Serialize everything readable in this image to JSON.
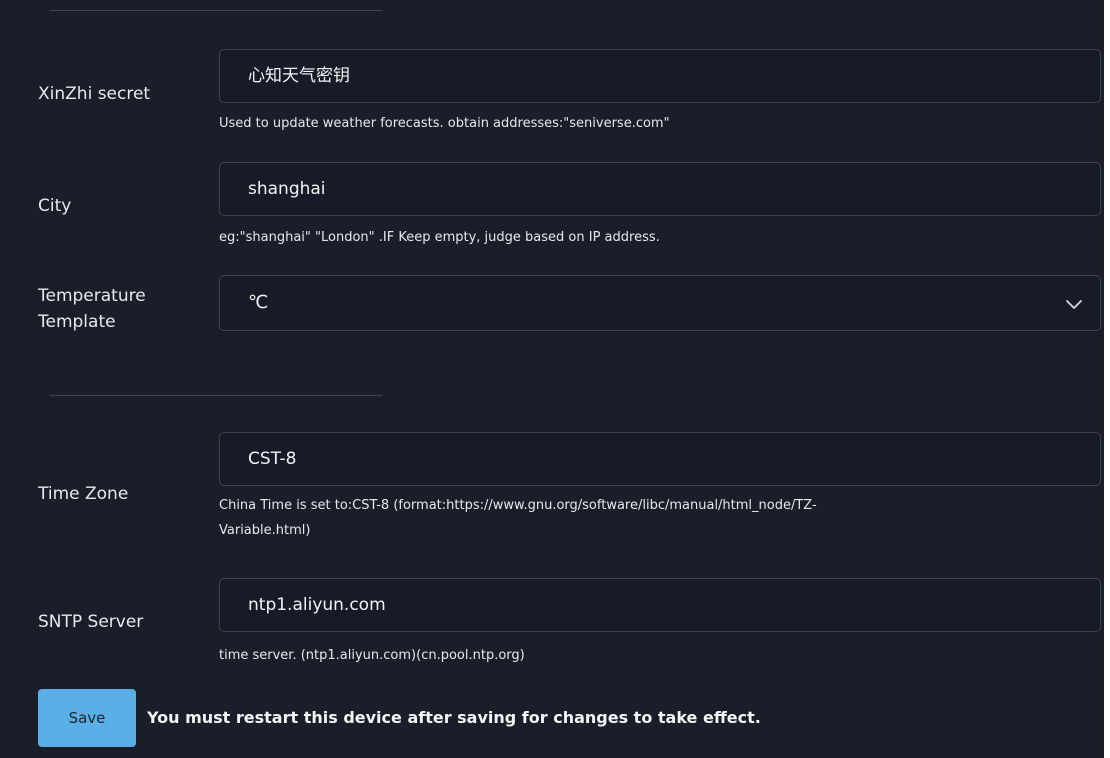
{
  "form": {
    "xinzhi": {
      "label": "XinZhi secret",
      "value": "心知天气密钥",
      "help": "Used to update weather forecasts. obtain addresses:\"seniverse.com\""
    },
    "city": {
      "label": "City",
      "value": "shanghai",
      "help": "eg:\"shanghai\" \"London\" .IF Keep empty, judge based on IP address."
    },
    "temperature": {
      "label_line1": "Temperature",
      "label_line2": "Template",
      "selected": "℃",
      "icon": "chevron-down-icon"
    },
    "timezone": {
      "label": "Time Zone",
      "value": "CST-8",
      "help_line1": "China Time is set to:CST-8 (format:https://www.gnu.org/software/libc/manual/html_node/TZ-",
      "help_line2": "Variable.html)"
    },
    "sntp": {
      "label": "SNTP Server",
      "value": "ntp1.aliyun.com",
      "help": "time server. (ntp1.aliyun.com)(cn.pool.ntp.org)"
    }
  },
  "footer": {
    "save_label": "Save",
    "notice": "You must restart this device after saving for changes to take effect."
  },
  "colors": {
    "background": "#1a1e28",
    "field_background": "#161b27",
    "field_border": "#3b4455",
    "save_button": "#5ab0e6",
    "text": "#e6e8ec"
  }
}
